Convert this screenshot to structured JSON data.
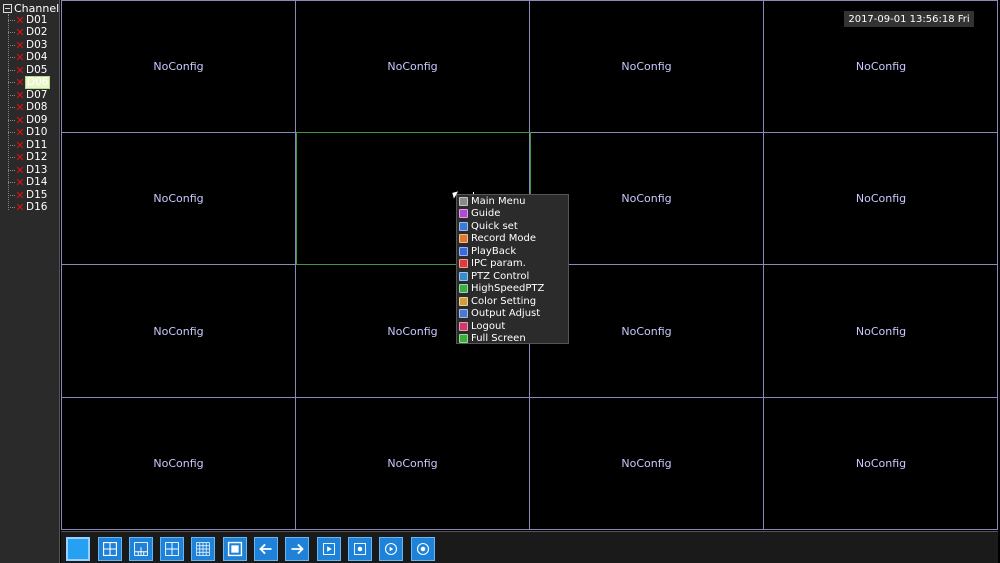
{
  "sidebar": {
    "header": "Channel",
    "channels": [
      "D01",
      "D02",
      "D03",
      "D04",
      "D05",
      "D06",
      "D07",
      "D08",
      "D09",
      "D10",
      "D11",
      "D12",
      "D13",
      "D14",
      "D15",
      "D16"
    ],
    "selected_index": 5
  },
  "grid": {
    "cell_label": "NoConfig",
    "cells": [
      "NoConfig",
      "NoConfig",
      "NoConfig",
      "NoConfig",
      "NoConfig",
      "",
      "NoConfig",
      "NoConfig",
      "NoConfig",
      "NoConfig",
      "NoConfig",
      "NoConfig",
      "NoConfig",
      "NoConfig",
      "NoConfig",
      "NoConfig"
    ]
  },
  "datetime": "2017-09-01 13:56:18 Fri",
  "context_menu": {
    "items": [
      {
        "label": "Main Menu",
        "icon": "main-menu-icon",
        "color": "#8a8a8a"
      },
      {
        "label": "Guide",
        "icon": "guide-icon",
        "color": "#b04ad0"
      },
      {
        "label": "Quick set",
        "icon": "quick-set-icon",
        "color": "#3a7ad8"
      },
      {
        "label": "Record Mode",
        "icon": "record-mode-icon",
        "color": "#e07a30"
      },
      {
        "label": "PlayBack",
        "icon": "playback-icon",
        "color": "#3a6ae0"
      },
      {
        "label": "IPC param.",
        "icon": "ipc-param-icon",
        "color": "#e03a3a"
      },
      {
        "label": "PTZ Control",
        "icon": "ptz-control-icon",
        "color": "#3a8ad0"
      },
      {
        "label": "HighSpeedPTZ",
        "icon": "high-speed-ptz-icon",
        "color": "#3ab04a"
      },
      {
        "label": "Color Setting",
        "icon": "color-setting-icon",
        "color": "#d0a040"
      },
      {
        "label": "Output Adjust",
        "icon": "output-adjust-icon",
        "color": "#4a7ad0"
      },
      {
        "label": "Logout",
        "icon": "logout-icon",
        "color": "#d03a6a"
      },
      {
        "label": "Full Screen",
        "icon": "full-screen-icon",
        "color": "#3ab03a"
      }
    ]
  },
  "toolbar": {
    "buttons": [
      {
        "icon": "layout-1-icon",
        "active": true
      },
      {
        "icon": "layout-4-icon",
        "active": false
      },
      {
        "icon": "layout-8-icon",
        "active": false
      },
      {
        "icon": "layout-9-icon",
        "active": false
      },
      {
        "icon": "layout-16-icon",
        "active": false
      },
      {
        "icon": "fullscreen-icon",
        "active": false
      },
      {
        "icon": "arrow-left-icon",
        "active": false
      },
      {
        "icon": "arrow-right-icon",
        "active": false
      },
      {
        "icon": "play-icon",
        "active": false
      },
      {
        "icon": "record-icon",
        "active": false
      },
      {
        "icon": "playback-circle-icon",
        "active": false
      },
      {
        "icon": "stop-circle-icon",
        "active": false
      }
    ]
  },
  "colors": {
    "grid_line": "#8a8ab8",
    "selected_cell_border": "#3c9a3c",
    "toolbar_button": "#1e82d8",
    "channel_error": "#e01010"
  }
}
